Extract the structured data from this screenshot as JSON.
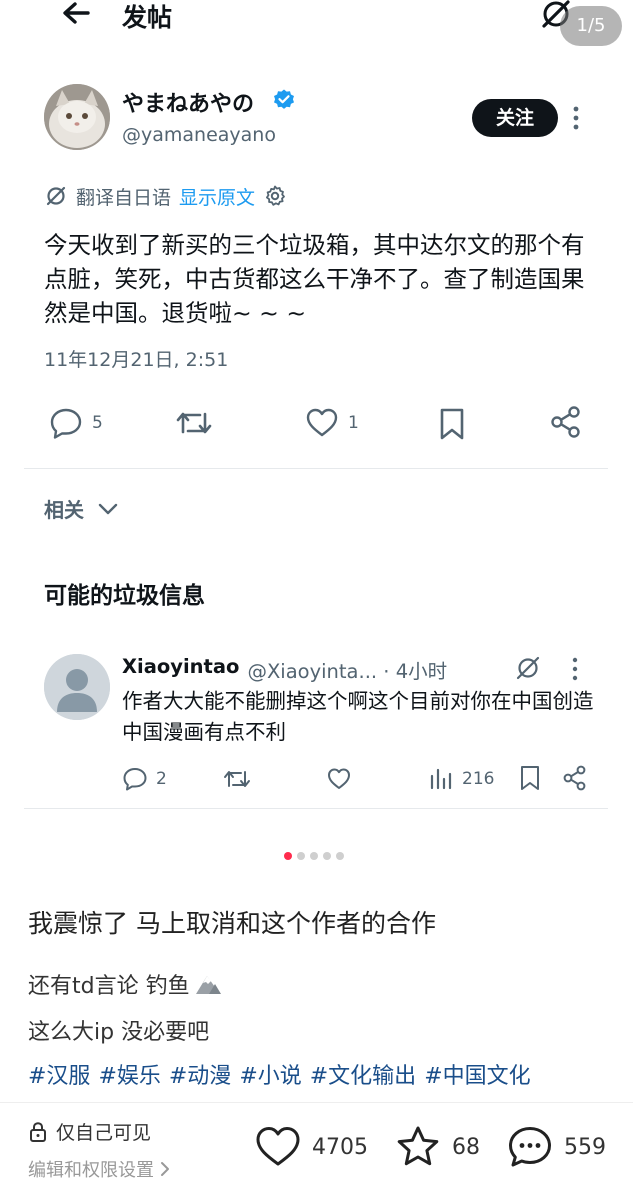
{
  "header": {
    "title": "发帖",
    "page_indicator": "1/5"
  },
  "tweet": {
    "display_name": "やまねあやの",
    "handle": "@yamaneayano",
    "follow_label": "关注",
    "translate_label": "翻译自日语",
    "show_original_label": "显示原文",
    "text": "今天收到了新买的三个垃圾箱，其中达尔文的那个有点脏，笑死，中古货都这么干净不了。查了制造国果然是中国。退货啦~ ~ ~",
    "timestamp": "11年12月21日, 2:51",
    "replies": "5",
    "likes": "1"
  },
  "related": {
    "label": "相关"
  },
  "spam_section": {
    "heading": "可能的垃圾信息"
  },
  "reply": {
    "name": "Xiaoyintao",
    "meta": "@Xiaoyinta... · 4小时",
    "text": "作者大大能不能删掉这个啊这个目前对你在中国创造中国漫画有点不利",
    "replies": "2",
    "views": "216"
  },
  "post": {
    "caption": "我震惊了 马上取消和这个作者的合作",
    "line1": "还有td言论 钓鱼",
    "line2": "这么大ip 没必要吧",
    "tags": [
      "#汉服",
      "#娱乐",
      "#动漫",
      "#小说",
      "#文化输出",
      "#中国文化"
    ]
  },
  "bottom": {
    "privacy": "仅自己可见",
    "edit_permissions": "编辑和权限设置",
    "likes": "4705",
    "favorites": "68",
    "comments": "559"
  },
  "colors": {
    "link_blue": "#1d9bf0",
    "muted": "#536471",
    "tag_blue": "#1a4e8a",
    "active_dot": "#ff2b4d"
  }
}
